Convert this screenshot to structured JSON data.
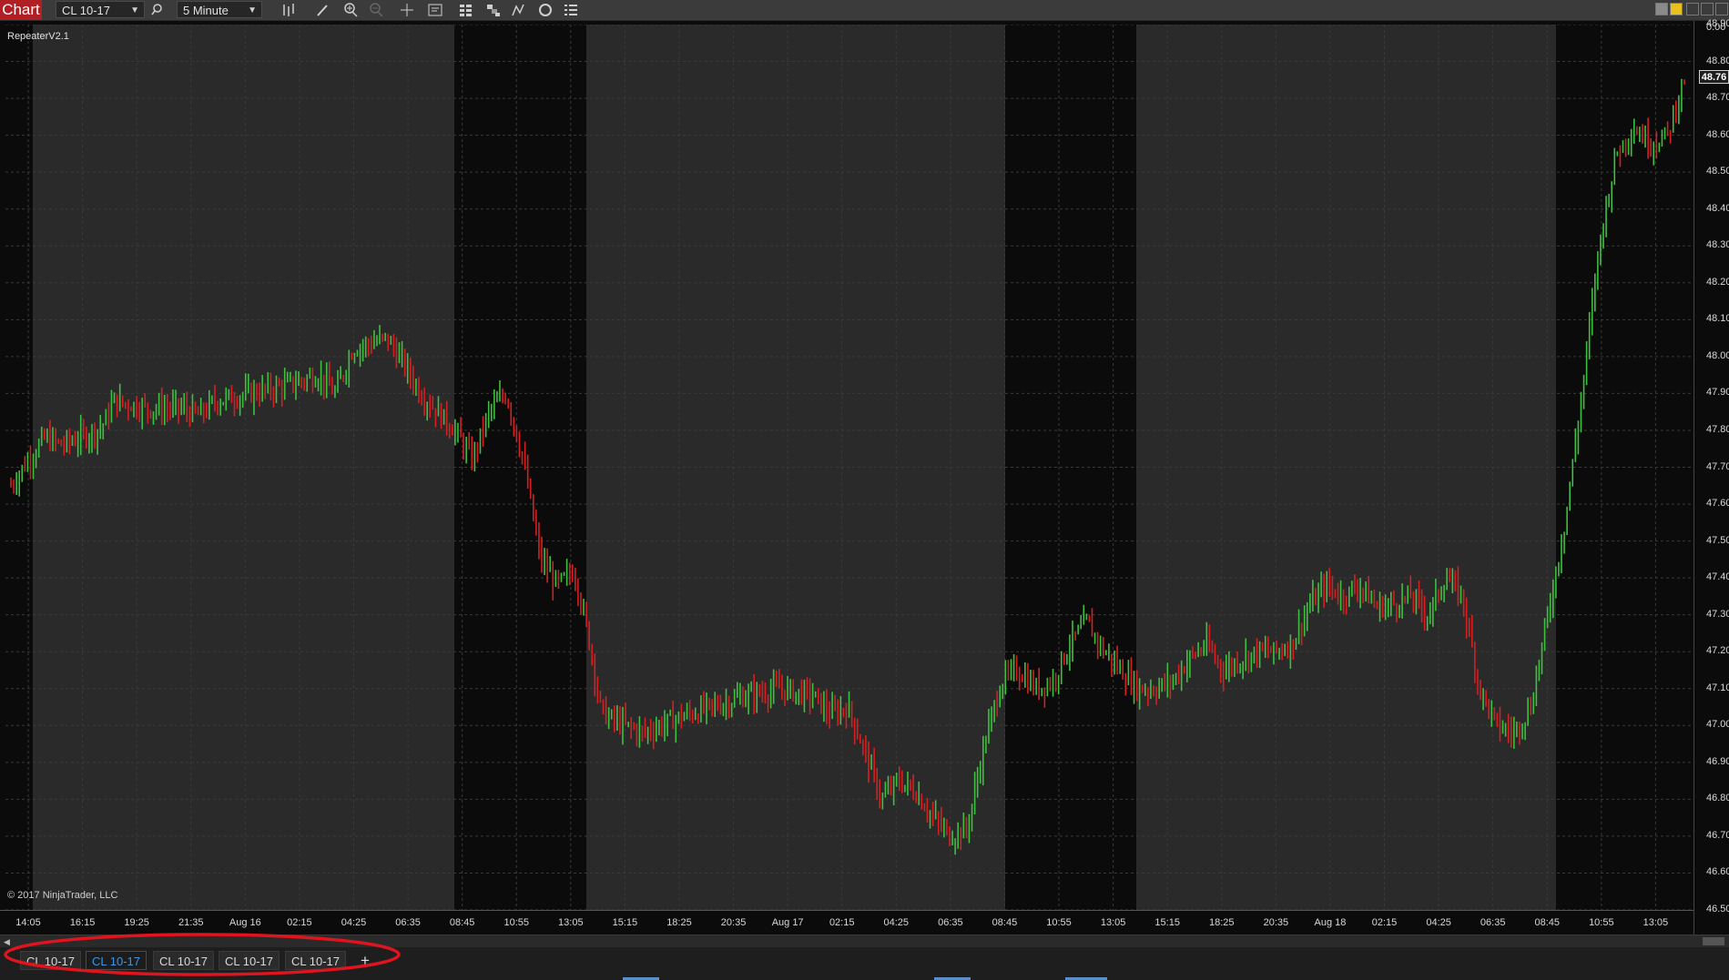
{
  "toolbar": {
    "chart_label": "Chart",
    "instrument": "CL 10-17",
    "interval": "5 Minute"
  },
  "chart": {
    "indicator": "RepeaterV2.1",
    "copyright": "© 2017 NinjaTrader, LLC",
    "current_price": "48.76",
    "price_axis_top_label": "0.00"
  },
  "chart_data": {
    "type": "ohlc",
    "title": "",
    "ylim": [
      46.5,
      48.9
    ],
    "y_ticks": [
      "48.90",
      "48.80",
      "48.70",
      "48.60",
      "48.50",
      "48.40",
      "48.30",
      "48.20",
      "48.10",
      "48.00",
      "47.90",
      "47.80",
      "47.70",
      "47.60",
      "47.50",
      "47.40",
      "47.30",
      "47.20",
      "47.10",
      "47.00",
      "46.90",
      "46.80",
      "46.70",
      "46.60",
      "46.50"
    ],
    "x_ticks": [
      "14:05",
      "16:15",
      "19:25",
      "21:35",
      "Aug 16",
      "02:15",
      "04:25",
      "06:35",
      "08:45",
      "10:55",
      "13:05",
      "15:15",
      "18:25",
      "20:35",
      "Aug 17",
      "02:15",
      "04:25",
      "06:35",
      "08:45",
      "10:55",
      "13:05",
      "15:15",
      "18:25",
      "20:35",
      "Aug 18",
      "02:15",
      "04:25",
      "06:35",
      "08:45",
      "10:55",
      "13:05"
    ],
    "price_path": [
      [
        0,
        47.65
      ],
      [
        2,
        47.72
      ],
      [
        4,
        47.78
      ],
      [
        6,
        47.76
      ],
      [
        8,
        47.78
      ],
      [
        10,
        47.8
      ],
      [
        11,
        47.82
      ],
      [
        12,
        47.88
      ],
      [
        16,
        47.86
      ],
      [
        20,
        47.86
      ],
      [
        22,
        47.84
      ],
      [
        24,
        47.88
      ],
      [
        28,
        47.9
      ],
      [
        32,
        47.92
      ],
      [
        36,
        47.95
      ],
      [
        38,
        47.9
      ],
      [
        40,
        48.02
      ],
      [
        44,
        48.05
      ],
      [
        46,
        47.98
      ],
      [
        48,
        47.9
      ],
      [
        50,
        47.85
      ],
      [
        52,
        47.8
      ],
      [
        54,
        47.72
      ],
      [
        56,
        47.85
      ],
      [
        58,
        47.9
      ],
      [
        60,
        47.72
      ],
      [
        62,
        47.45
      ],
      [
        64,
        47.38
      ],
      [
        66,
        47.42
      ],
      [
        68,
        47.2
      ],
      [
        69,
        47.05
      ],
      [
        70,
        47.02
      ],
      [
        74,
        46.98
      ],
      [
        78,
        47.02
      ],
      [
        82,
        47.05
      ],
      [
        86,
        47.08
      ],
      [
        90,
        47.1
      ],
      [
        94,
        47.08
      ],
      [
        96,
        47.03
      ],
      [
        98,
        47.05
      ],
      [
        100,
        46.93
      ],
      [
        102,
        46.8
      ],
      [
        104,
        46.85
      ],
      [
        106,
        46.82
      ],
      [
        108,
        46.75
      ],
      [
        110,
        46.7
      ],
      [
        112,
        46.72
      ],
      [
        114,
        46.95
      ],
      [
        116,
        47.12
      ],
      [
        118,
        47.15
      ],
      [
        120,
        47.1
      ],
      [
        122,
        47.12
      ],
      [
        124,
        47.22
      ],
      [
        126,
        47.28
      ],
      [
        128,
        47.2
      ],
      [
        130,
        47.15
      ],
      [
        132,
        47.1
      ],
      [
        134,
        47.1
      ],
      [
        136,
        47.12
      ],
      [
        138,
        47.18
      ],
      [
        140,
        47.22
      ],
      [
        142,
        47.15
      ],
      [
        144,
        47.18
      ],
      [
        146,
        47.2
      ],
      [
        148,
        47.2
      ],
      [
        150,
        47.22
      ],
      [
        152,
        47.32
      ],
      [
        154,
        47.38
      ],
      [
        156,
        47.35
      ],
      [
        158,
        47.38
      ],
      [
        160,
        47.32
      ],
      [
        162,
        47.33
      ],
      [
        164,
        47.35
      ],
      [
        166,
        47.3
      ],
      [
        168,
        47.4
      ],
      [
        170,
        47.35
      ],
      [
        172,
        47.1
      ],
      [
        174,
        47.0
      ],
      [
        176,
        46.98
      ],
      [
        178,
        47.05
      ],
      [
        180,
        47.3
      ],
      [
        182,
        47.55
      ],
      [
        184,
        47.9
      ],
      [
        186,
        48.3
      ],
      [
        188,
        48.55
      ],
      [
        190,
        48.62
      ],
      [
        192,
        48.58
      ],
      [
        194,
        48.6
      ],
      [
        196,
        48.76
      ]
    ]
  },
  "tabs": [
    {
      "label": "CL 10-17"
    },
    {
      "label": "CL 10-17"
    },
    {
      "label": "CL 10-17"
    },
    {
      "label": "CL 10-17"
    },
    {
      "label": "CL 10-17"
    }
  ],
  "colors": {
    "up": "#3fbf3f",
    "down": "#d42020",
    "session_shade": "#2a2a2a",
    "background": "#0b0b0b",
    "active_tab": "#3d97e6",
    "annotation": "#e0141e"
  }
}
